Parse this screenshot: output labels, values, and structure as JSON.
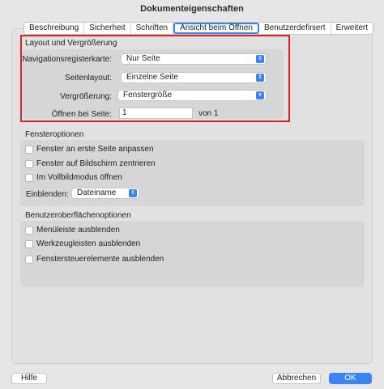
{
  "window": {
    "title": "Dokumenteigenschaften"
  },
  "tabs": [
    {
      "label": "Beschreibung",
      "active": false
    },
    {
      "label": "Sicherheit",
      "active": false
    },
    {
      "label": "Schriften",
      "active": false
    },
    {
      "label": "Ansicht beim Öffnen",
      "active": true
    },
    {
      "label": "Benutzerdefiniert",
      "active": false
    },
    {
      "label": "Erweitert",
      "active": false
    }
  ],
  "layout_group": {
    "title": "Layout und Vergrößerung",
    "nav_label": "Navigationsregisterkarte:",
    "nav_value": "Nur Seite",
    "page_layout_label": "Seitenlayout:",
    "page_layout_value": "Einzelne Seite",
    "zoom_label": "Vergrößerung:",
    "zoom_value": "Fenstergröße",
    "open_page_label": "Öffnen bei Seite:",
    "open_page_value": "1",
    "of_label": "von 1"
  },
  "window_options": {
    "title": "Fensteroptionen",
    "checkboxes": [
      "Fenster an erste Seite anpassen",
      "Fenster auf Bildschirm zentrieren",
      "Im Vollbildmodus öffnen"
    ],
    "show_label": "Einblenden:",
    "show_value": "Dateiname"
  },
  "ui_options": {
    "title": "Benutzeroberflächenoptionen",
    "checkboxes": [
      "Menüleiste ausblenden",
      "Werkzeugleisten ausblenden",
      "Fenstersteuerelemente ausblenden"
    ]
  },
  "footer": {
    "help": "Hilfe",
    "cancel": "Abbrechen",
    "ok": "OK"
  },
  "colors": {
    "accent": "#3a84f5",
    "highlight": "#e02424"
  }
}
